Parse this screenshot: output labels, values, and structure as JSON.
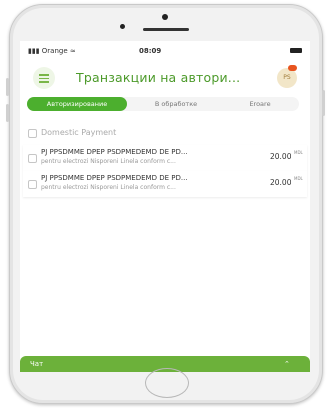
{
  "status_bar": {
    "carrier": "Orange",
    "time": "08:09"
  },
  "header": {
    "title": "Транзакции на автори...",
    "avatar_initials": "PS"
  },
  "tabs": [
    {
      "label": "Авторизирование",
      "active": true
    },
    {
      "label": "В обработке",
      "active": false
    },
    {
      "label": "Eroare",
      "active": false
    }
  ],
  "section": {
    "label": "Domestic Payment"
  },
  "transactions": [
    {
      "title": "PJ PPSDMME DPEP PSDPMEDEMD DE PD...",
      "description": "pentru electrozi Nisporeni Linela conform c...",
      "amount": "20.00",
      "currency": "MDL"
    },
    {
      "title": "PJ PPSDMME DPEP PSDPMEDEMD DE PD...",
      "description": "pentru electrozi Nisporeni Linela conform c...",
      "amount": "20.00",
      "currency": "MDL"
    }
  ],
  "chat": {
    "label": "Чат"
  },
  "colors": {
    "accent": "#4caf2e",
    "title": "#4c9a2a",
    "badge": "#e8541f",
    "chat_bar": "#6cb13a"
  },
  "icons": {
    "menu": "hamburger-menu-icon",
    "chat_toggle": "chevron-up-icon"
  }
}
